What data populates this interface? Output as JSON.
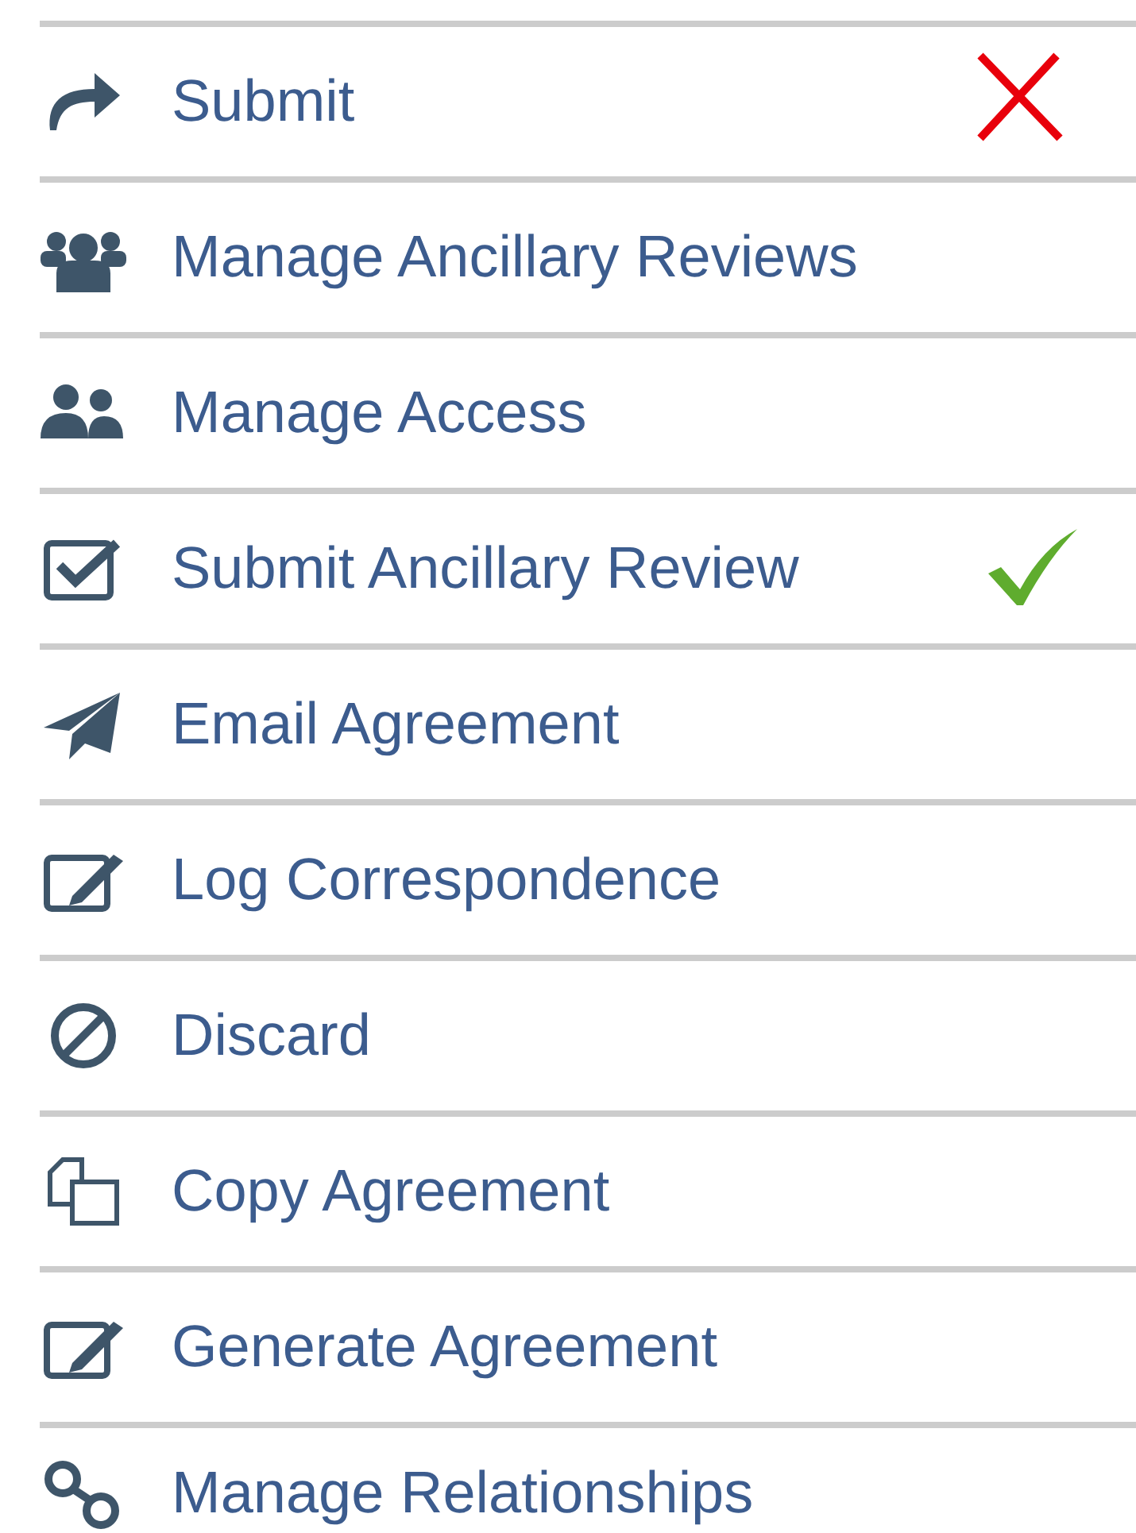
{
  "menu": {
    "items": [
      {
        "label": "Submit",
        "rejected": true
      },
      {
        "label": "Manage Ancillary Reviews"
      },
      {
        "label": "Manage Access"
      },
      {
        "label": "Submit Ancillary Review",
        "approved": true
      },
      {
        "label": "Email Agreement"
      },
      {
        "label": "Log Correspondence"
      },
      {
        "label": "Discard"
      },
      {
        "label": "Copy Agreement"
      },
      {
        "label": "Generate Agreement"
      },
      {
        "label": "Manage Relationships"
      }
    ]
  }
}
